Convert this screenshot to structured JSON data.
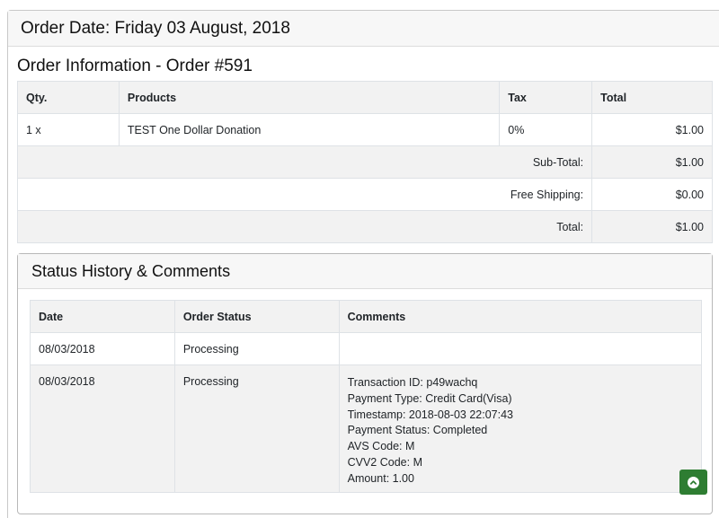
{
  "page": {
    "order_date_heading": "Order Date: Friday 03 August, 2018",
    "order_info_title": "Order Information - Order #591"
  },
  "order_table": {
    "headers": {
      "qty": "Qty.",
      "products": "Products",
      "tax": "Tax",
      "total": "Total"
    },
    "items": [
      {
        "qty": "1 x",
        "product": "TEST One Dollar Donation",
        "tax": "0%",
        "total": "$1.00"
      }
    ],
    "totals": [
      {
        "label": "Sub-Total:",
        "value": "$1.00"
      },
      {
        "label": "Free Shipping:",
        "value": "$0.00"
      },
      {
        "label": "Total:",
        "value": "$1.00"
      }
    ]
  },
  "status_history": {
    "title": "Status History & Comments",
    "headers": {
      "date": "Date",
      "status": "Order Status",
      "comments": "Comments"
    },
    "rows": [
      {
        "date": "08/03/2018",
        "status": "Processing",
        "comments": []
      },
      {
        "date": "08/03/2018",
        "status": "Processing",
        "comments": [
          "Transaction ID: p49wachq",
          "Payment Type: Credit Card(Visa)",
          "Timestamp: 2018-08-03 22:07:43",
          "Payment Status: Completed",
          "AVS Code: M",
          "CVV2 Code: M",
          "Amount: 1.00"
        ]
      }
    ]
  },
  "colors": {
    "scroll_button": "#2e7d32",
    "header_bg": "#f7f7f7",
    "row_shade": "#f2f2f2"
  },
  "icons": {
    "scroll_top": "chevron-up-circle-icon"
  }
}
